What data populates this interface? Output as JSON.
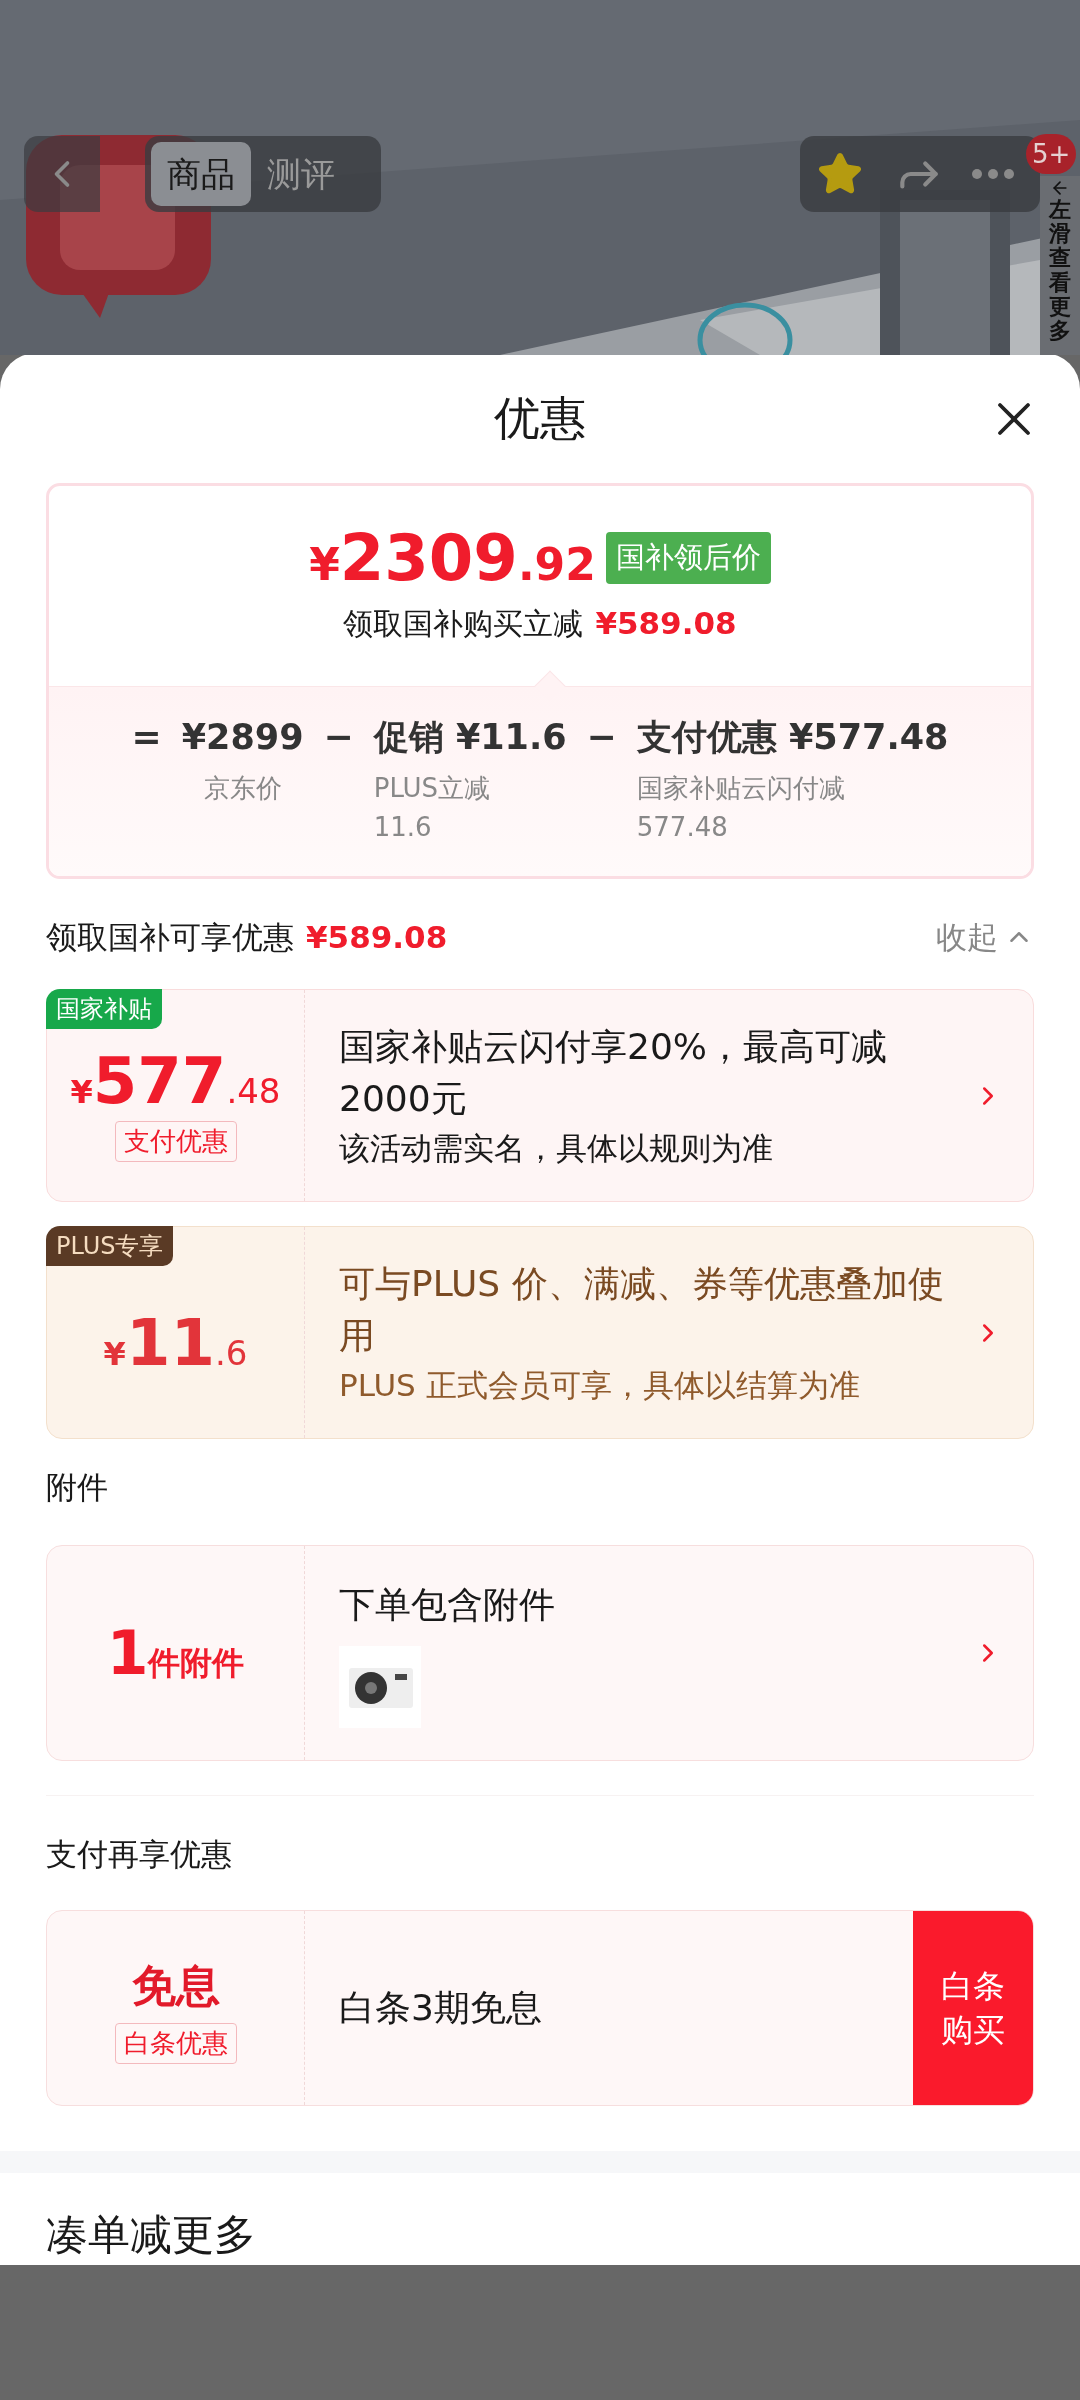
{
  "top_bar": {
    "tabs": [
      {
        "label": "商品",
        "selected": true
      },
      {
        "label": "测评",
        "selected": false
      }
    ],
    "favorited": true,
    "badge": "5+",
    "side_hint": "左滑查看更多"
  },
  "sheet": {
    "title": "优惠",
    "summary": {
      "currency": "¥",
      "price_integer": "2309",
      "price_decimal": ".92",
      "price_tag": "国补领后价",
      "saving_label": "领取国补购买立减",
      "saving_amount": "¥589.08",
      "breakdown": [
        {
          "operator": "=",
          "value": "¥2899",
          "label": "京东价"
        },
        {
          "operator": "−",
          "value": "促销 ¥11.6",
          "label": "PLUS立减",
          "detail": "11.6"
        },
        {
          "operator": "−",
          "value": "支付优惠 ¥577.48",
          "label": "国家补贴云闪付减",
          "detail": "577.48"
        }
      ]
    },
    "offers_section": {
      "title": "领取国补可享优惠",
      "amount": "¥589.08",
      "toggle": "收起",
      "expanded": true,
      "offers": [
        {
          "kind": "subsidy",
          "tag": "国家补贴",
          "currency": "¥",
          "integer": "577",
          "decimal": ".48",
          "sub_tag": "支付优惠",
          "title": "国家补贴云闪付享20%，最高可减2000元",
          "description": "该活动需实名，具体以规则为准"
        },
        {
          "kind": "plus",
          "tag": "PLUS专享",
          "currency": "¥",
          "integer": "11",
          "decimal": ".6",
          "title": "可与PLUS 价、满减、券等优惠叠加使用",
          "description": "PLUS 正式会员可享，具体以结算为准"
        }
      ]
    },
    "accessories": {
      "title": "附件",
      "count": "1",
      "unit": "件附件",
      "text": "下单包含附件"
    },
    "payment": {
      "title": "支付再享优惠",
      "main": "免息",
      "sub_tag": "白条优惠",
      "text": "白条3期免息",
      "button": "白条购买"
    },
    "more": {
      "title": "凑单减更多"
    }
  }
}
